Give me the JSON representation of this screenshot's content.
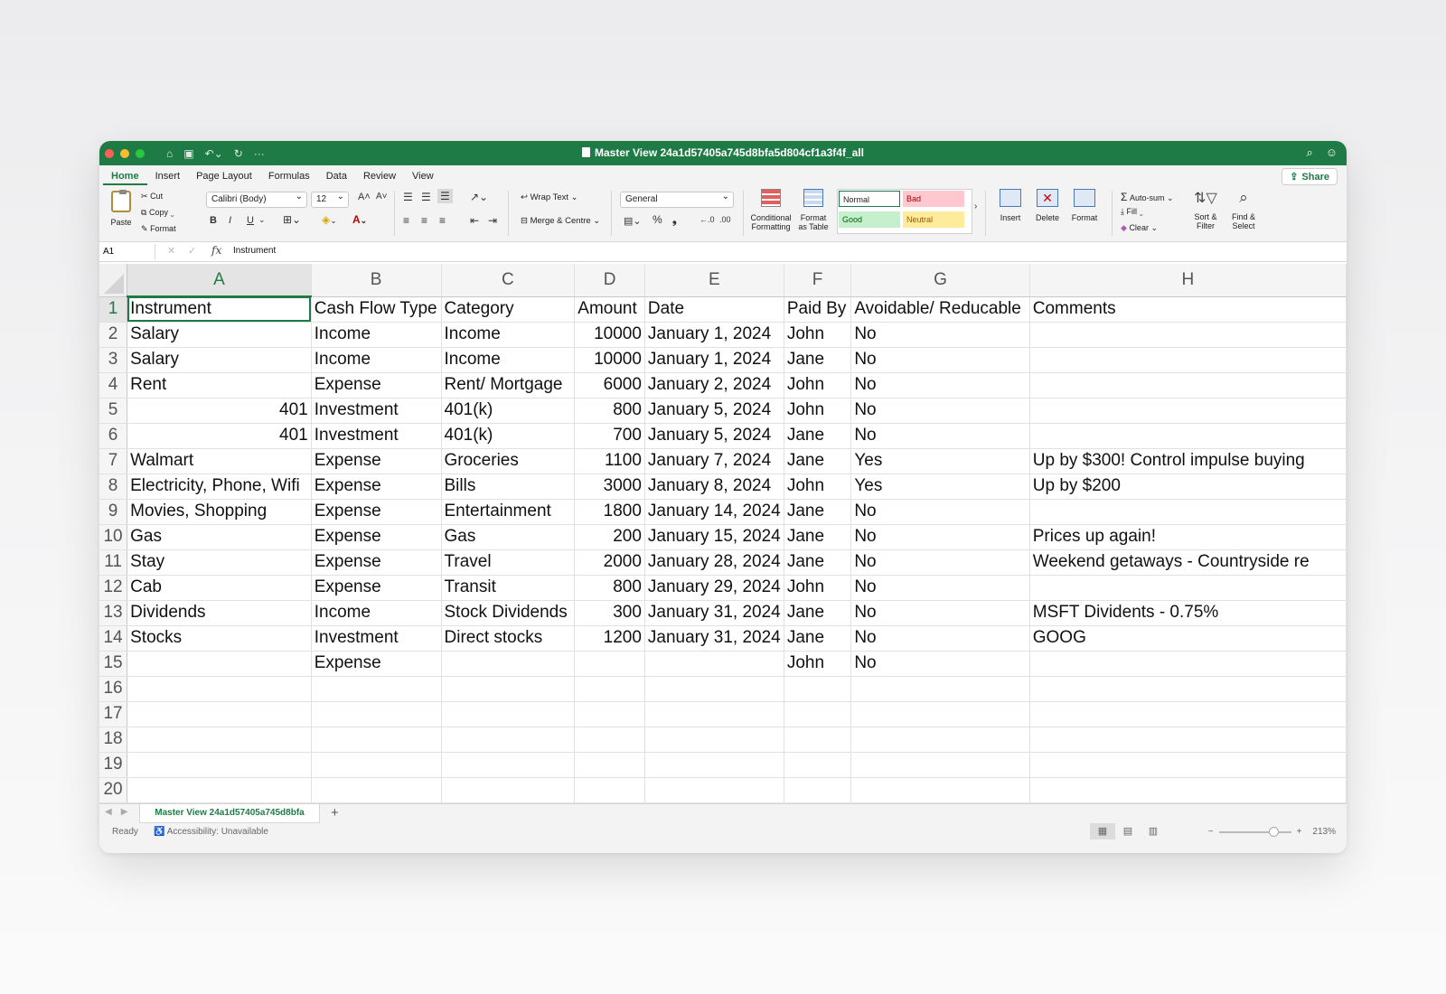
{
  "window": {
    "title": "Master View 24a1d57405a745d8bfa5d804cf1a3f4f_all"
  },
  "menu_tabs": [
    "Home",
    "Insert",
    "Page Layout",
    "Formulas",
    "Data",
    "Review",
    "View"
  ],
  "share_label": "Share",
  "ribbon": {
    "paste": "Paste",
    "cut": "Cut",
    "copy": "Copy",
    "format_painter": "Format",
    "font_name": "Calibri (Body)",
    "font_size": "12",
    "wrap_text": "Wrap Text",
    "merge_centre": "Merge & Centre",
    "number_format": "General",
    "conditional_formatting_1": "Conditional",
    "conditional_formatting_2": "Formatting",
    "format_table_1": "Format",
    "format_table_2": "as Table",
    "styles": {
      "normal": "Normal",
      "bad": "Bad",
      "good": "Good",
      "neutral": "Neutral"
    },
    "insert": "Insert",
    "delete": "Delete",
    "format": "Format",
    "auto_sum": "Auto-sum",
    "fill": "Fill",
    "clear": "Clear",
    "sort_filter_1": "Sort &",
    "sort_filter_2": "Filter",
    "find_select_1": "Find &",
    "find_select_2": "Select",
    "bold": "B",
    "italic": "I",
    "underline": "U"
  },
  "formula_bar": {
    "name_box": "A1",
    "content": "Instrument"
  },
  "columns": [
    "A",
    "B",
    "C",
    "D",
    "E",
    "F",
    "G",
    "H"
  ],
  "rows": [
    {
      "n": "1",
      "cells": [
        "Instrument",
        "Cash Flow Type",
        "Category",
        "Amount",
        "Date",
        "Paid By",
        "Avoidable/ Reducable",
        "Comments"
      ]
    },
    {
      "n": "2",
      "cells": [
        "Salary",
        "Income",
        "Income",
        "10000",
        "January 1, 2024",
        "John",
        "No",
        ""
      ]
    },
    {
      "n": "3",
      "cells": [
        "Salary",
        "Income",
        "Income",
        "10000",
        "January 1, 2024",
        "Jane",
        "No",
        ""
      ]
    },
    {
      "n": "4",
      "cells": [
        "Rent",
        "Expense",
        "Rent/ Mortgage",
        "6000",
        "January 2, 2024",
        "John",
        "No",
        ""
      ]
    },
    {
      "n": "5",
      "cells": [
        "401",
        "Investment",
        "401(k)",
        "800",
        "January 5, 2024",
        "John",
        "No",
        ""
      ]
    },
    {
      "n": "6",
      "cells": [
        "401",
        "Investment",
        "401(k)",
        "700",
        "January 5, 2024",
        "Jane",
        "No",
        ""
      ]
    },
    {
      "n": "7",
      "cells": [
        "Walmart",
        "Expense",
        "Groceries",
        "1100",
        "January 7, 2024",
        "Jane",
        "Yes",
        "Up by $300! Control impulse buying"
      ]
    },
    {
      "n": "8",
      "cells": [
        "Electricity, Phone, Wifi",
        "Expense",
        "Bills",
        "3000",
        "January 8, 2024",
        "John",
        "Yes",
        "Up by $200"
      ]
    },
    {
      "n": "9",
      "cells": [
        "Movies, Shopping",
        "Expense",
        "Entertainment",
        "1800",
        "January 14, 2024",
        "Jane",
        "No",
        ""
      ]
    },
    {
      "n": "10",
      "cells": [
        "Gas",
        "Expense",
        "Gas",
        "200",
        "January 15, 2024",
        "Jane",
        "No",
        "Prices up again!"
      ]
    },
    {
      "n": "11",
      "cells": [
        "Stay",
        "Expense",
        "Travel",
        "2000",
        "January 28, 2024",
        "Jane",
        "No",
        "Weekend getaways - Countryside re"
      ]
    },
    {
      "n": "12",
      "cells": [
        "Cab",
        "Expense",
        "Transit",
        "800",
        "January 29, 2024",
        "John",
        "No",
        ""
      ]
    },
    {
      "n": "13",
      "cells": [
        "Dividends",
        "Income",
        "Stock Dividends",
        "300",
        "January 31, 2024",
        "Jane",
        "No",
        "MSFT Dividents - 0.75%"
      ]
    },
    {
      "n": "14",
      "cells": [
        "Stocks",
        "Investment",
        "Direct stocks",
        "1200",
        "January 31, 2024",
        "Jane",
        "No",
        "GOOG"
      ]
    },
    {
      "n": "15",
      "cells": [
        "",
        "Expense",
        "",
        "",
        "",
        "John",
        "No",
        ""
      ]
    },
    {
      "n": "16",
      "cells": [
        "",
        "",
        "",
        "",
        "",
        "",
        "",
        ""
      ]
    },
    {
      "n": "17",
      "cells": [
        "",
        "",
        "",
        "",
        "",
        "",
        "",
        ""
      ]
    },
    {
      "n": "18",
      "cells": [
        "",
        "",
        "",
        "",
        "",
        "",
        "",
        ""
      ]
    },
    {
      "n": "19",
      "cells": [
        "",
        "",
        "",
        "",
        "",
        "",
        "",
        ""
      ]
    },
    {
      "n": "20",
      "cells": [
        "",
        "",
        "",
        "",
        "",
        "",
        "",
        ""
      ]
    }
  ],
  "sheet_tab": "Master View 24a1d57405a745d8bfa5d804cf1a3f4f",
  "sheet_tab_visible": "Master View 24a1d57405a745d8bfa",
  "status": {
    "ready": "Ready",
    "accessibility": "Accessibility: Unavailable",
    "zoom": "213%",
    "zoom_fraction": 0.75
  },
  "colors": {
    "accent": "#1e7b45",
    "bad_fill": "#ffc7ce",
    "good_fill": "#c6efce",
    "neutral_fill": "#ffeb9c"
  }
}
